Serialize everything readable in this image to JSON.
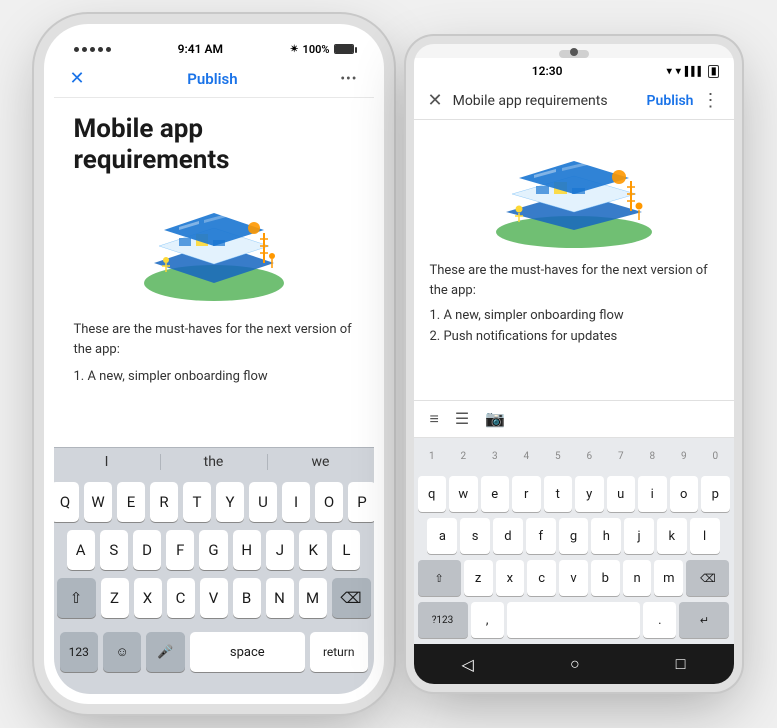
{
  "ios": {
    "status": {
      "dots": 5,
      "time": "9:41 AM",
      "bluetooth": "⌽",
      "battery": "100%"
    },
    "toolbar": {
      "close_label": "✕",
      "publish_label": "Publish",
      "more_label": "•••"
    },
    "content": {
      "title": "Mobile app requirements",
      "body": "These are the must-haves for the next version of the app:",
      "list_items": [
        "1. A new, simpler onboarding flow"
      ]
    },
    "autocomplete": [
      "I",
      "the",
      "we"
    ],
    "keyboard_rows": [
      [
        "Q",
        "W",
        "E",
        "R",
        "T",
        "Y",
        "U",
        "I",
        "O",
        "P"
      ],
      [
        "A",
        "S",
        "D",
        "F",
        "G",
        "H",
        "J",
        "K",
        "L"
      ],
      [
        "Z",
        "X",
        "C",
        "V",
        "B",
        "N",
        "M"
      ]
    ],
    "bottom_row": {
      "num": "123",
      "emoji": "☺",
      "mic": "🎤",
      "space": "space",
      "return": "return"
    }
  },
  "android": {
    "status": {
      "time": "12:30",
      "icons": "▾ ▾ ▮"
    },
    "toolbar": {
      "close_label": "✕",
      "page_title": "Mobile app requirements",
      "publish_label": "Publish",
      "more_label": "⋮"
    },
    "content": {
      "body": "These are the must-haves for the next version of the app:",
      "list_items": [
        "1. A new, simpler onboarding flow",
        "2. Push notifications for updates"
      ]
    },
    "keyboard_numbers": [
      "1",
      "2",
      "3",
      "4",
      "5",
      "6",
      "7",
      "8",
      "9",
      "0"
    ],
    "keyboard_rows": [
      [
        "q",
        "w",
        "e",
        "r",
        "t",
        "y",
        "u",
        "i",
        "o",
        "p"
      ],
      [
        "a",
        "s",
        "d",
        "f",
        "g",
        "h",
        "j",
        "k",
        "l"
      ],
      [
        "z",
        "x",
        "c",
        "v",
        "b",
        "n",
        "m"
      ]
    ],
    "nav": {
      "back": "◁",
      "home": "○",
      "recents": "□"
    }
  }
}
